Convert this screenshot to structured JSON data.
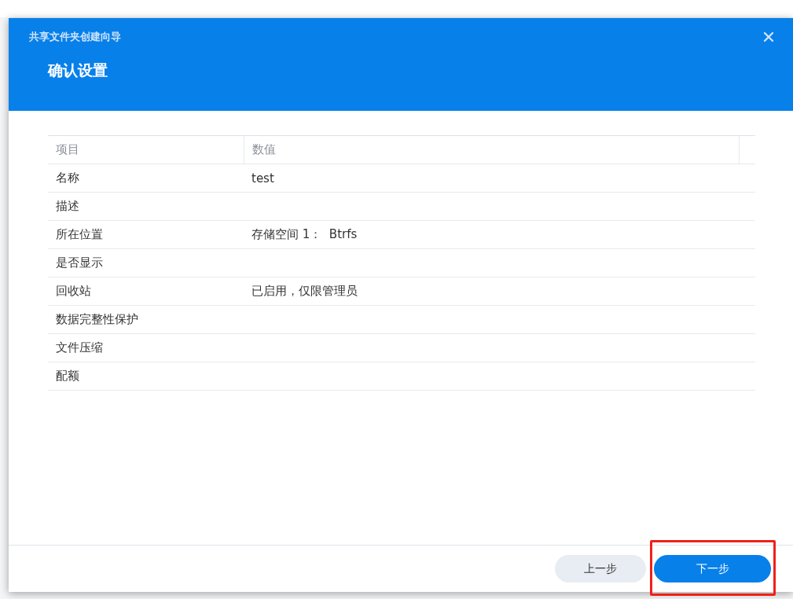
{
  "dialog": {
    "window_title": "共享文件夹创建向导",
    "step_title": "确认设置"
  },
  "table": {
    "columns": [
      "项目",
      "数值"
    ],
    "rows": [
      {
        "item": "名称",
        "value": "test"
      },
      {
        "item": "描述",
        "value": ""
      },
      {
        "item": "所在位置",
        "value": "存储空间 1：  Btrfs"
      },
      {
        "item": "是否显示",
        "value": ""
      },
      {
        "item": "回收站",
        "value": "已启用，仅限管理员"
      },
      {
        "item": "数据完整性保护",
        "value": ""
      },
      {
        "item": "文件压缩",
        "value": ""
      },
      {
        "item": "配额",
        "value": ""
      }
    ]
  },
  "buttons": [
    {
      "label": "上一步",
      "kind": "secondary",
      "highlighted": false
    },
    {
      "label": "下一步",
      "kind": "primary",
      "highlighted": true
    }
  ]
}
